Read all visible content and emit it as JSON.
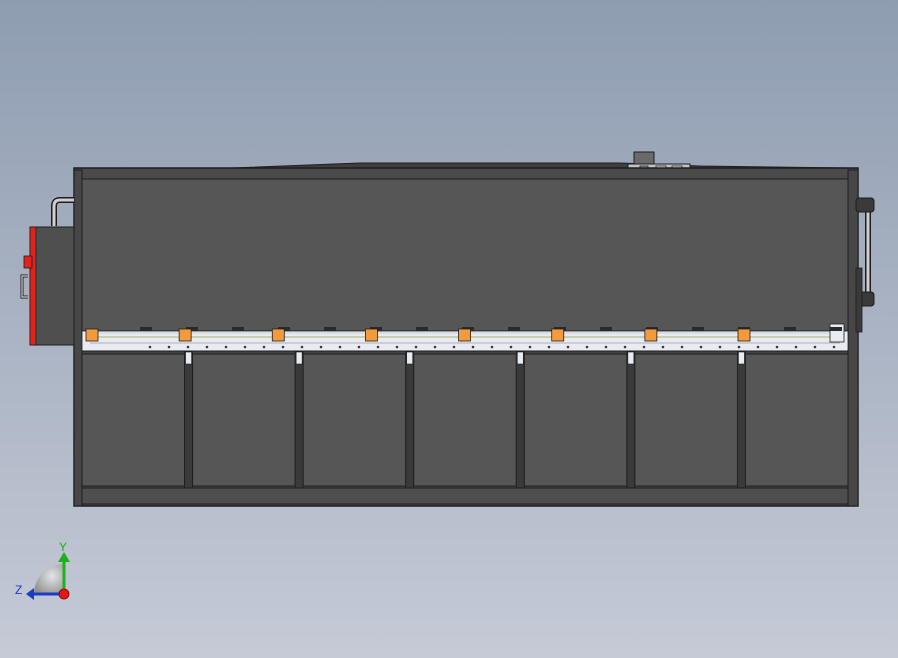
{
  "scene": {
    "background_top": "#8f9db1",
    "background_bottom": "#c5cad6",
    "body_color": "#565656",
    "frame_color": "#4a4a4a",
    "edge_color": "#1e1e1e",
    "accent_red": "#e2231c",
    "pad_orange": "#f39a3c",
    "blade_light": "#e8ecf2"
  },
  "triad": {
    "y_label": "Y",
    "z_label": "Z",
    "y_color": "#1db21d",
    "z_color": "#1c3cc8",
    "x_dot_color": "#e01818"
  },
  "machine": {
    "clamp_pad_count": 8,
    "lower_bay_count": 7,
    "icons": [
      "hydraulic-pipe-icon",
      "control-box-icon",
      "handle-icon"
    ]
  }
}
